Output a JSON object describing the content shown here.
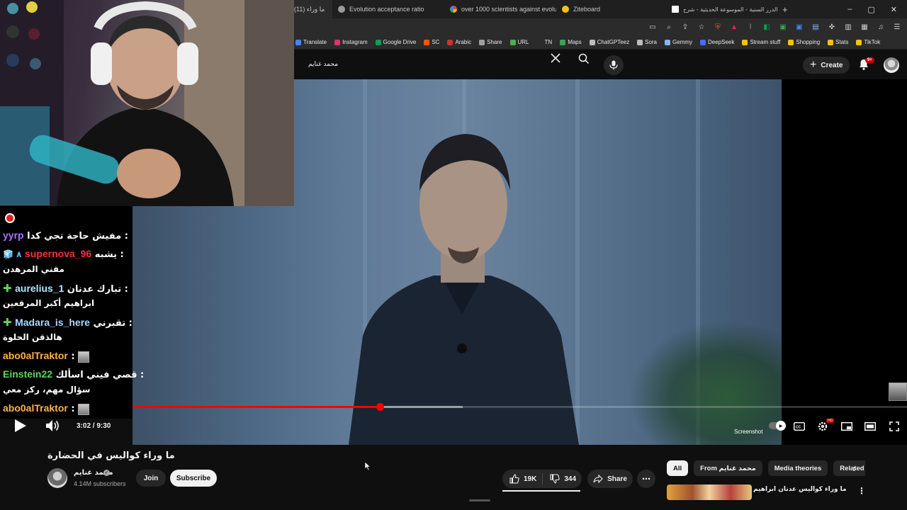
{
  "browser": {
    "tabs": [
      {
        "label": "(11) ما وراء",
        "icon_color": "#ff0000",
        "active": true
      },
      {
        "label": "Evolution acceptance ratio",
        "icon_color": "#9a9a9a"
      },
      {
        "label": "over 1000 scientists against evolution",
        "icon_color": "#4285f4"
      },
      {
        "label": "Ziteboard",
        "icon_color": "#f4c20d"
      },
      {
        "label": "الدرر السنية - الموسوعة الحديثية - شرح",
        "icon_color": "#ffffff"
      }
    ],
    "new_tab_symbol": "+",
    "window_controls": [
      "–",
      "▢",
      "✕"
    ],
    "bookmarks": [
      {
        "label": "Translate",
        "color": "#4285f4"
      },
      {
        "label": "Instagram",
        "color": "#e1306c"
      },
      {
        "label": "Google Drive",
        "color": "#0f9d58"
      },
      {
        "label": "SC",
        "color": "#ff5500"
      },
      {
        "label": "Arabic",
        "color": "#d32f2f"
      },
      {
        "label": "Share",
        "color": "#9e9e9e"
      },
      {
        "label": "URL",
        "color": "#4caf50"
      },
      {
        "label": "TN",
        "color": "#2b2b2b"
      },
      {
        "label": "Maps",
        "color": "#34a853"
      },
      {
        "label": "ChatGPTeez",
        "color": "#bdbdbd"
      },
      {
        "label": "Sora",
        "color": "#bdbdbd"
      },
      {
        "label": "Gemmy",
        "color": "#8ab4f8"
      },
      {
        "label": "DeepSeek",
        "color": "#4d6bfe"
      },
      {
        "label": "Stream stuff",
        "color": "#f4c20d"
      },
      {
        "label": "Shopping",
        "color": "#f4c20d"
      },
      {
        "label": "Stats",
        "color": "#f4c20d"
      },
      {
        "label": "TikTok",
        "color": "#f4c20d"
      }
    ]
  },
  "youtube": {
    "search_value": "محمد غنايم",
    "create_label": "Create",
    "notifications_badge": "9+",
    "player": {
      "time": "3:02 / 9:30",
      "progress_fraction": 0.3193,
      "buffer_fraction": 0.4263,
      "screenshot_label": "Screenshot",
      "hd_badge": "HD"
    },
    "video": {
      "title": "ما وراء كواليس في الحضارة",
      "channel_name": "محمد غنايم",
      "subscribers": "4.14M subscribers",
      "join_label": "Join",
      "subscribe_label": "Subscribe",
      "likes": "19K",
      "dislikes": "344",
      "share_label": "Share"
    },
    "chips": [
      {
        "label": "All",
        "active": true
      },
      {
        "label": "From محمد غنايم",
        "active": false
      },
      {
        "label": "Media theories",
        "active": false
      },
      {
        "label": "Related",
        "active": false
      }
    ],
    "recommended_title": "ما وراء كواليس عدنان ابراهيم"
  },
  "chat": [
    {
      "user": "yyrp",
      "user_color": "#a970ff",
      "message": "مفيش حاجة تجي كدا",
      "badge": ""
    },
    {
      "user": "supernova_96",
      "user_color": "#ff2e3a",
      "message": "يشبه",
      "badge": "🧊 ٨",
      "continuation": "مقني المرهدن"
    },
    {
      "user": "aurelius_1",
      "user_color": "#b5e8ff",
      "message": "تبارك عدنان",
      "badge": "✚",
      "continuation": "ابراهيم أكبر المرقعين"
    },
    {
      "user": "Madara_is_here",
      "user_color": "#a8d8ff",
      "message": "تقبرني",
      "badge": "✚",
      "continuation": "هالذقن الحلوة"
    },
    {
      "user": "abo0alTraktor",
      "user_color": "#ffb347",
      "message": "",
      "badge": "avatar"
    },
    {
      "user": "Einstein22",
      "user_color": "#5cd65c",
      "message": "قصي فيني اسألك",
      "badge": "",
      "continuation": "سؤال مهم، ركز معي"
    },
    {
      "user": "abo0alTraktor",
      "user_color": "#ffb347",
      "message": "",
      "badge": "avatar"
    }
  ]
}
